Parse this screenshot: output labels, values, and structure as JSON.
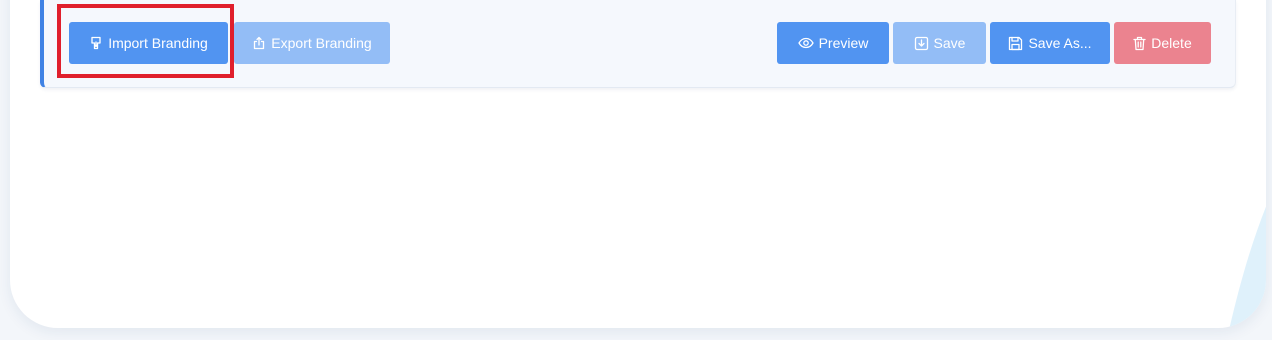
{
  "toolbar": {
    "import_label": "Import Branding",
    "export_label": "Export Branding",
    "preview_label": "Preview",
    "save_label": "Save",
    "save_as_label": "Save As...",
    "delete_label": "Delete"
  },
  "icons": {
    "import": "import-icon",
    "export": "export-icon",
    "preview": "eye-icon",
    "save": "save-icon",
    "save_as": "floppy-disk-icon",
    "delete": "trash-icon"
  },
  "colors": {
    "primary_button": "#5194f1",
    "disabled_button": "#93bdf6",
    "danger_button": "#eb838f",
    "accent_border": "#3f82e4",
    "highlight_box": "#e01f2c",
    "wave": "#42c3f7"
  },
  "states": {
    "export_enabled": false,
    "save_enabled": false,
    "delete_enabled": false
  }
}
